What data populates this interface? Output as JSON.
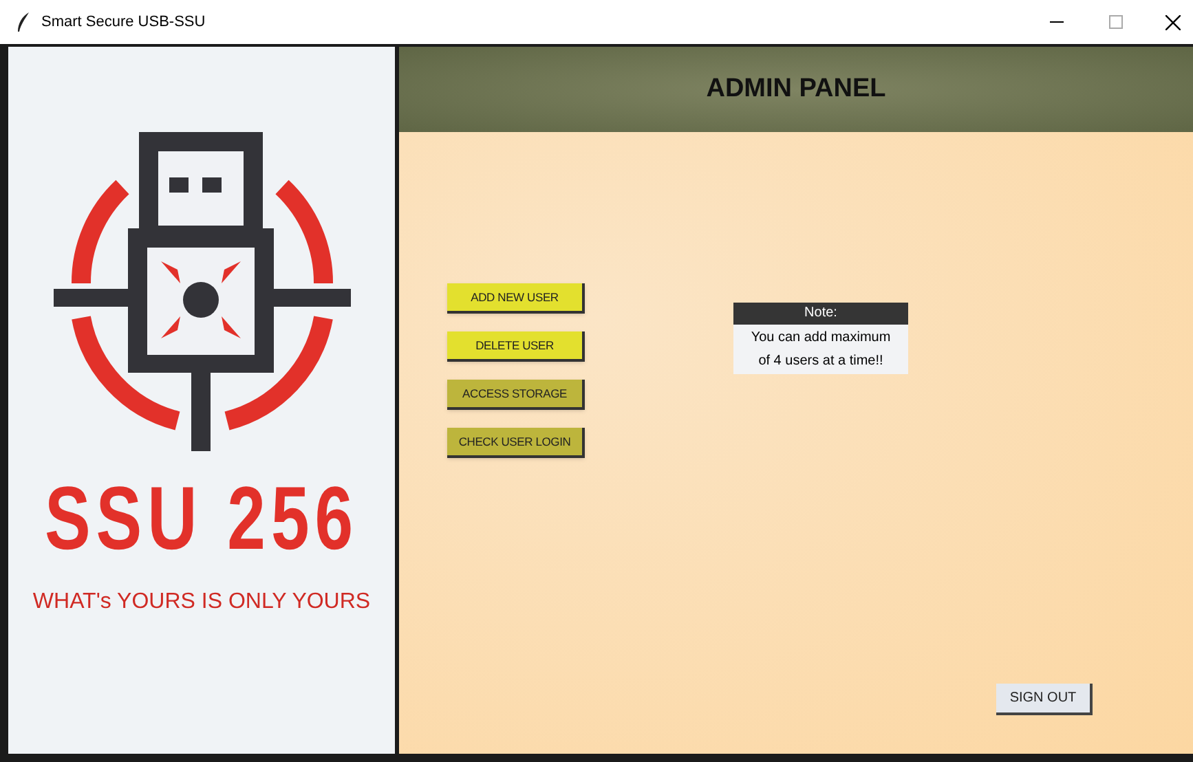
{
  "window": {
    "title": "Smart Secure USB-SSU"
  },
  "brand": {
    "name": "SSU 256",
    "tagline": "WHAT's YOURS IS ONLY YOURS"
  },
  "header": {
    "title": "ADMIN PANEL"
  },
  "buttons": [
    {
      "label": "ADD NEW USER",
      "color": "#e3e02e"
    },
    {
      "label": "DELETE USER",
      "color": "#e3e02e"
    },
    {
      "label": "ACCESS STORAGE",
      "color": "#bdb53c"
    },
    {
      "label": "CHECK USER LOGIN",
      "color": "#bdb53c"
    }
  ],
  "note": {
    "title": "Note:",
    "text": "You can add maximum of 4 users at a time!!"
  },
  "sign_out": {
    "label": "SIGN OUT"
  }
}
